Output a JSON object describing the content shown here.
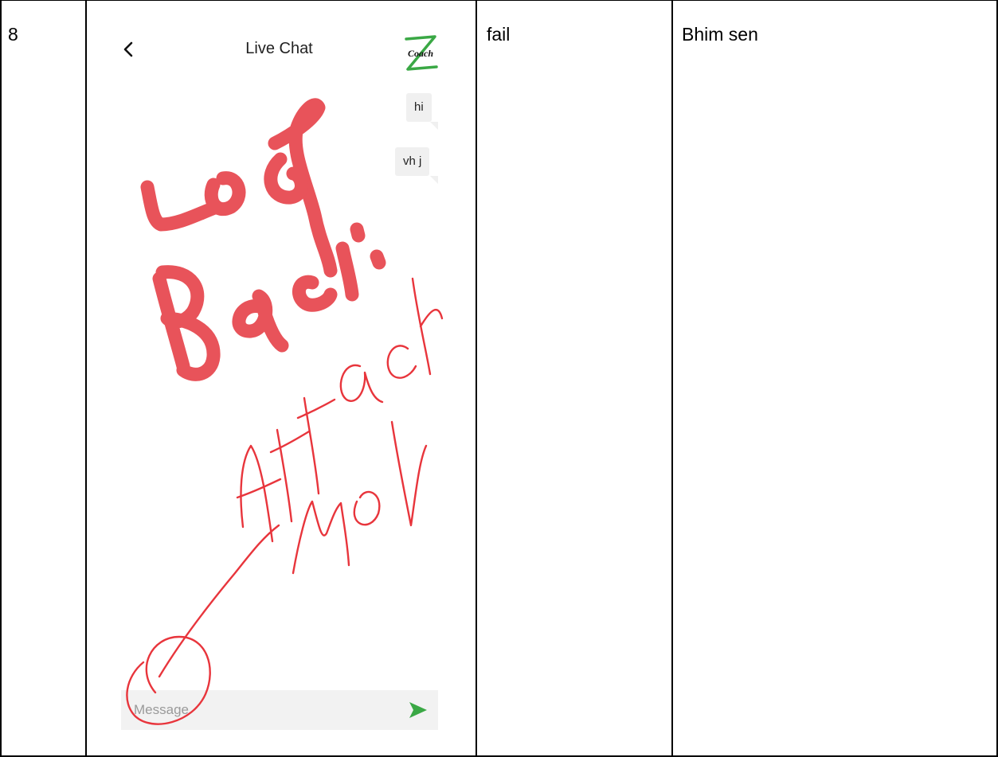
{
  "row": {
    "number": "8",
    "result": "fail",
    "tester": "Bhim sen"
  },
  "screenshot": {
    "header": {
      "title": "Live Chat",
      "back_icon": "chevron-left-icon",
      "logo_text": "Coach"
    },
    "messages": [
      {
        "text": "hi"
      },
      {
        "text": "vh j"
      }
    ],
    "composer": {
      "placeholder": "Message",
      "send_icon": "send-arrow-icon"
    },
    "annotation_color": "#e8353c",
    "accent_color": "#3aa845"
  }
}
